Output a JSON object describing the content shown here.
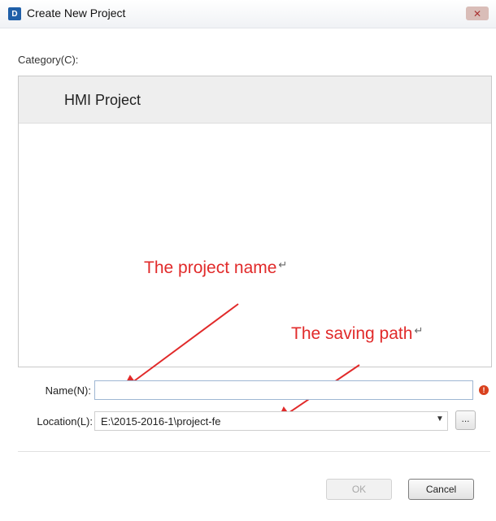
{
  "window": {
    "title": "Create New Project",
    "icon_text": "D",
    "close_glyph": "✕"
  },
  "category": {
    "label": "Category(C):",
    "items": [
      {
        "label": "HMI Project",
        "selected": true
      }
    ]
  },
  "annotations": {
    "project_name": "The project name",
    "saving_path": "The saving path",
    "return_glyph": "↵",
    "color": "#e12a2a"
  },
  "form": {
    "name_label": "Name(N):",
    "name_value": "",
    "error_glyph": "!",
    "location_label": "Location(L):",
    "location_value": "E:\\2015-2016-1\\project-fe",
    "dropdown_glyph": "▼",
    "browse_label": "..."
  },
  "buttons": {
    "ok": "OK",
    "cancel": "Cancel",
    "ok_enabled": false
  }
}
